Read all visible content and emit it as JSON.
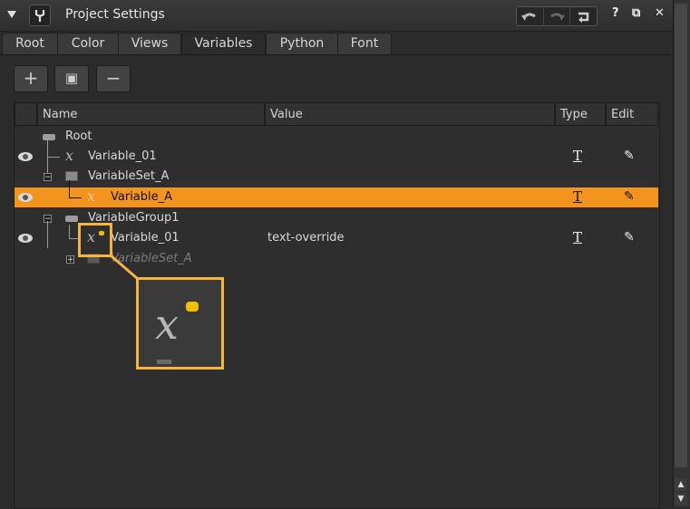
{
  "window": {
    "title": "Project Settings"
  },
  "tabs": [
    "Root",
    "Color",
    "Views",
    "Variables",
    "Python",
    "Font"
  ],
  "active_tab": "Variables",
  "actions": {
    "add": "+",
    "add_set": "▣",
    "remove": "−"
  },
  "table": {
    "columns": {
      "name": "Name",
      "value": "Value",
      "type": "Type",
      "edit": "Edit"
    },
    "rows": [
      {
        "name": "Root",
        "value": ""
      },
      {
        "name": "Variable_01",
        "value": ""
      },
      {
        "name": "VariableSet_A",
        "value": ""
      },
      {
        "name": "Variable_A",
        "value": ""
      },
      {
        "name": "VariableGroup1",
        "value": ""
      },
      {
        "name": "Variable_01",
        "value": "text-override"
      },
      {
        "name": "VariableSet_A",
        "value": ""
      }
    ]
  },
  "icons": {
    "type": "T",
    "edit": "✎",
    "variable": "𝑥"
  },
  "colors": {
    "selection": "#f3941f",
    "highlight": "#f6b53f",
    "override_badge": "#f0c000"
  },
  "window_controls": {
    "help": "?",
    "float": "⧉",
    "close": "✕"
  }
}
